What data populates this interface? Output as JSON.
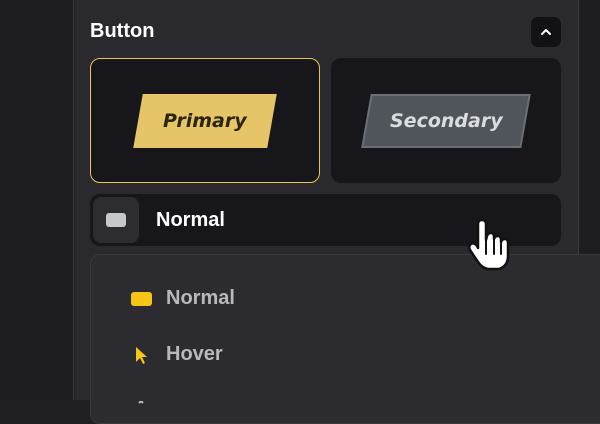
{
  "section": {
    "title": "Button"
  },
  "cards": {
    "primary_label": "Primary",
    "secondary_label": "Secondary"
  },
  "state_select": {
    "value": "Normal"
  },
  "dropdown": {
    "options": [
      {
        "label": "Normal",
        "icon": "yellow-swatch-icon"
      },
      {
        "label": "Hover",
        "icon": "arrow-cursor-icon"
      }
    ]
  },
  "colors": {
    "accent": "#f5c518",
    "primary_fill": "#e5c567",
    "secondary_fill": "#50555b"
  }
}
